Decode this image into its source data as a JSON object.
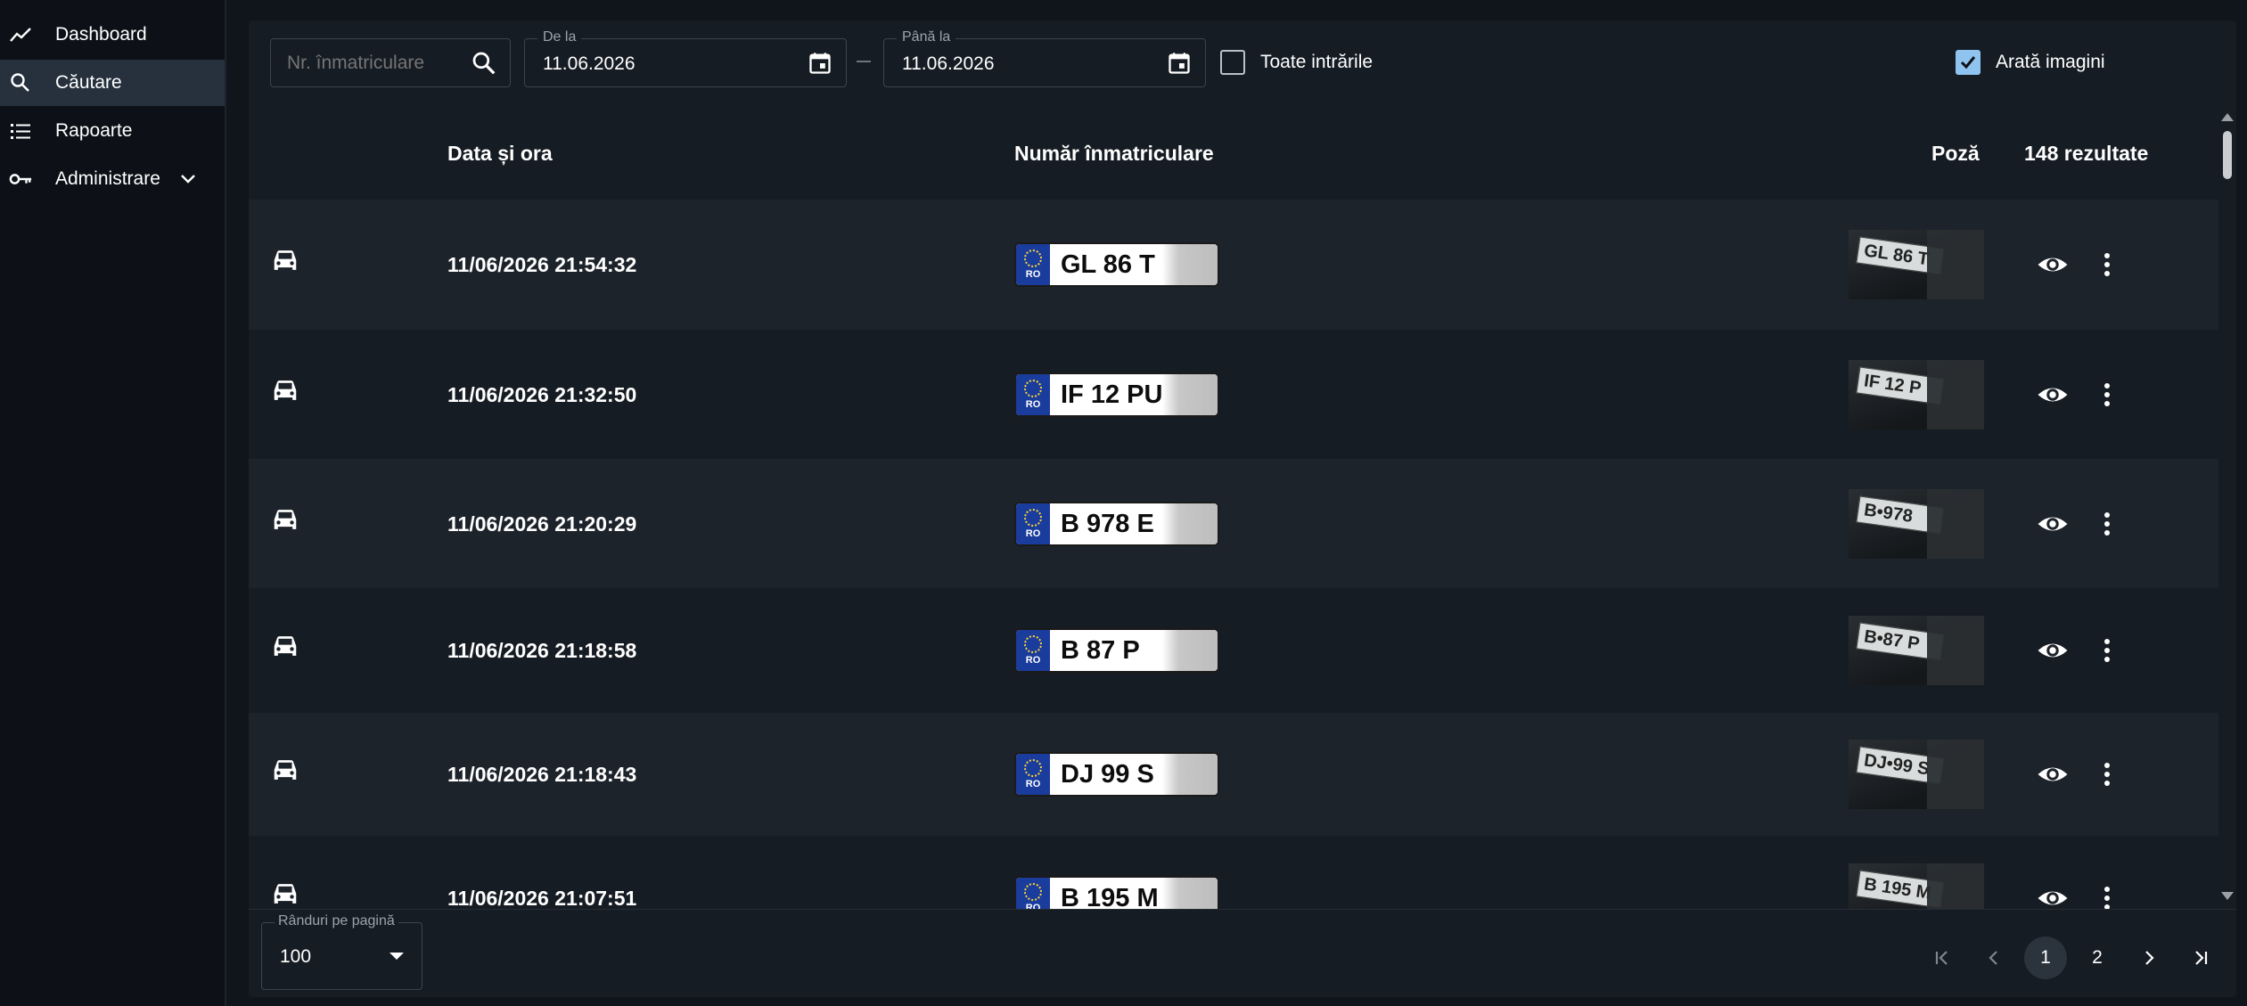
{
  "sidebar": {
    "items": [
      {
        "label": "Dashboard",
        "icon": "trend-line-icon"
      },
      {
        "label": "Căutare",
        "icon": "search-icon",
        "active": true
      },
      {
        "label": "Rapoarte",
        "icon": "list-icon"
      },
      {
        "label": "Administrare",
        "icon": "key-icon",
        "expandable": true
      }
    ]
  },
  "toolbar": {
    "search_placeholder": "Nr. înmatriculare",
    "from_label": "De la",
    "from_value": "11.06.2026",
    "to_label": "Până la",
    "to_value": "11.06.2026",
    "all_entries_label": "Toate intrările",
    "all_entries_checked": false,
    "show_images_label": "Arată imagini",
    "show_images_checked": true
  },
  "table": {
    "headers": {
      "datetime": "Data și ora",
      "plate": "Număr înmatriculare",
      "photo": "Poză",
      "results": "148 rezultate"
    },
    "rows": [
      {
        "datetime": "11/06/2026 21:54:32",
        "plate_country": "RO",
        "plate_text": "GL 86 T",
        "photo_text": "GL 86 T"
      },
      {
        "datetime": "11/06/2026 21:32:50",
        "plate_country": "RO",
        "plate_text": "IF 12 PU",
        "photo_text": "IF 12 P"
      },
      {
        "datetime": "11/06/2026 21:20:29",
        "plate_country": "RO",
        "plate_text": "B 978 E",
        "photo_text": "B•978"
      },
      {
        "datetime": "11/06/2026 21:18:58",
        "plate_country": "RO",
        "plate_text": "B 87 P",
        "photo_text": "B•87 P"
      },
      {
        "datetime": "11/06/2026 21:18:43",
        "plate_country": "RO",
        "plate_text": "DJ 99 S",
        "photo_text": "DJ•99 S"
      },
      {
        "datetime": "11/06/2026 21:07:51",
        "plate_country": "RO",
        "plate_text": "B 195 M",
        "photo_text": "B 195 M"
      }
    ]
  },
  "footer": {
    "rows_per_page_label": "Rânduri pe pagină",
    "rows_per_page_value": "100",
    "pages": [
      "1",
      "2"
    ],
    "current_page": "1"
  },
  "colors": {
    "background": "#10151b",
    "panel": "#161c23",
    "row_alt": "#1d232b",
    "accent_check": "#90c4f0",
    "plate_eu_blue": "#1a3c9c"
  }
}
